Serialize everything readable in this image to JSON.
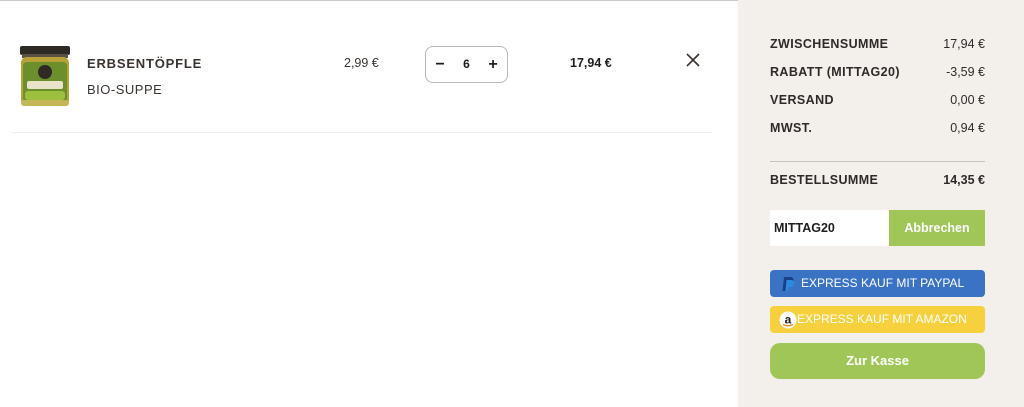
{
  "cart": {
    "item": {
      "name": "ERBSENTÖPFLE",
      "subtitle": "BIO-SUPPE",
      "unit_price": "2,99 €",
      "quantity": "6",
      "quantity_decrease": "−",
      "quantity_increase": "+",
      "line_total": "17,94 €",
      "image_icon": "soup-jar-image",
      "remove_icon": "close-icon"
    }
  },
  "summary": {
    "subtotal_label": "ZWISCHENSUMME",
    "subtotal_value": "17,94 €",
    "discount_label": "RABATT (MITTAG20)",
    "discount_value": "-3,59 €",
    "shipping_label": "VERSAND",
    "shipping_value": "0,00 €",
    "tax_label": "MWST.",
    "tax_value": "0,94 €",
    "total_label": "BESTELLSUMME",
    "total_value": "14,35 €",
    "coupon_code": "MITTAG20",
    "coupon_cancel": "Abbrechen",
    "paypal_label": "EXPRESS KAUF MIT PAYPAL",
    "amazon_label": "EXPRESS KAUF MIT AMAZON",
    "checkout_label": "Zur Kasse"
  },
  "colors": {
    "panel_bg": "#f3efeb",
    "accent_green": "#9fc657",
    "paypal_blue": "#3a73c4",
    "amazon_yellow": "#f6d13d",
    "text_dark": "#3a3431"
  }
}
